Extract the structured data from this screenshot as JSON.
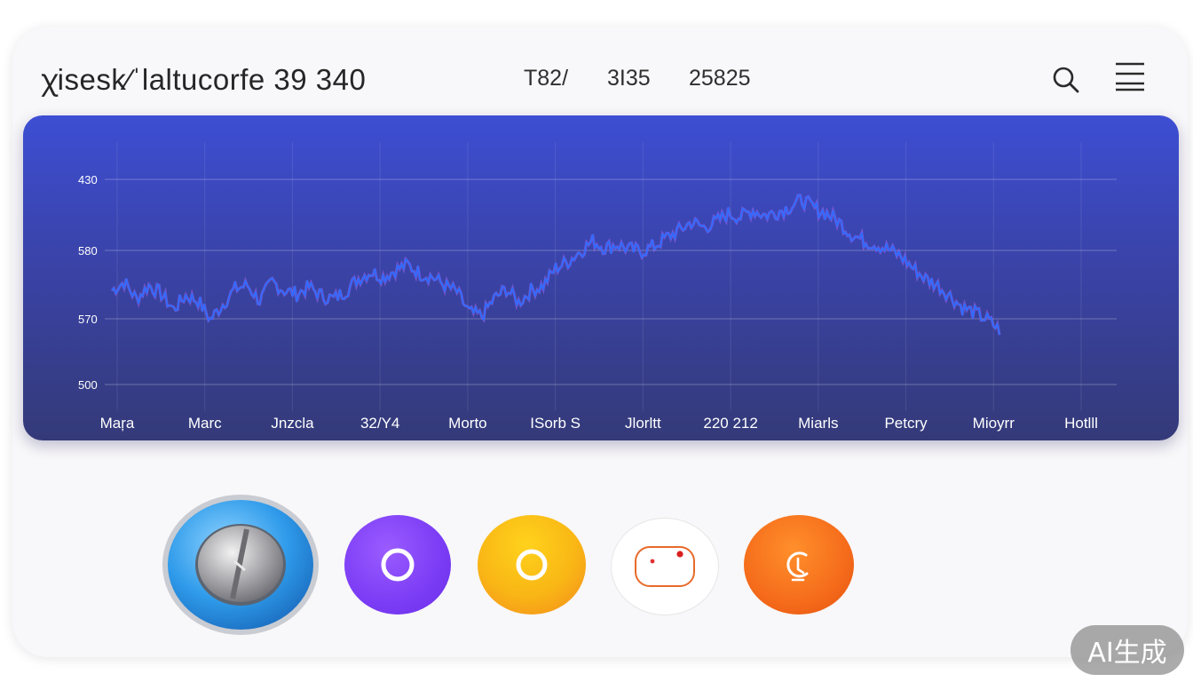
{
  "header": {
    "title": "ꭓisesk∕ˈlaltucorfe 39 340",
    "stats": [
      "T82/",
      "3I35",
      "25825"
    ],
    "search_icon": "search-icon",
    "menu_icon": "hamburger-menu-icon"
  },
  "chart_data": {
    "type": "line",
    "y_ticks": [
      "430",
      "580",
      "570",
      "500"
    ],
    "x_ticks": [
      "Maŗa",
      "Marc",
      "Jnzcla",
      "32/Y4",
      "Morto",
      "ISorb S",
      "Jlorltt",
      "220 212",
      "Miarls",
      "Petcry",
      "Mioyrr",
      "Hotlll"
    ],
    "grid": true,
    "colors": {
      "line": "#2f6bff",
      "highlight": "#b86bff",
      "panel_top": "#3d4ed3",
      "panel_bottom": "#343a78"
    },
    "series": [
      {
        "values": [
          0.55,
          0.6,
          0.5,
          0.58,
          0.53,
          0.44,
          0.52,
          0.49,
          0.38,
          0.47,
          0.56,
          0.58,
          0.49,
          0.6,
          0.55,
          0.53,
          0.57,
          0.52,
          0.5,
          0.55,
          0.62,
          0.66,
          0.63,
          0.67,
          0.7,
          0.65,
          0.63,
          0.58,
          0.54,
          0.42,
          0.4,
          0.5,
          0.56,
          0.48,
          0.55,
          0.58,
          0.68,
          0.72,
          0.78,
          0.84,
          0.8,
          0.82,
          0.79,
          0.78,
          0.81,
          0.86,
          0.9,
          0.95,
          0.92,
          0.95,
          1.0,
          0.98,
          1.02,
          0.99,
          1.01,
          1.04,
          1.08,
          1.03,
          1.0,
          0.95,
          0.88,
          0.84,
          0.82,
          0.79,
          0.75,
          0.68,
          0.62,
          0.58,
          0.52,
          0.45,
          0.42,
          0.38,
          0.32
        ]
      }
    ],
    "y_range_norm": [
      0.0,
      1.2
    ]
  },
  "actions": {
    "colors": {
      "dial": "#38a3ee",
      "purple": "#7b3cf5",
      "yellow": "#f7a11c",
      "white": "#ffffff",
      "orange": "#f26a1b"
    },
    "icons": [
      "dial-knob-icon",
      "ring-icon",
      "ring-icon",
      "chat-bubble-icon",
      "refresh-icon"
    ]
  },
  "watermark": "AI生成"
}
